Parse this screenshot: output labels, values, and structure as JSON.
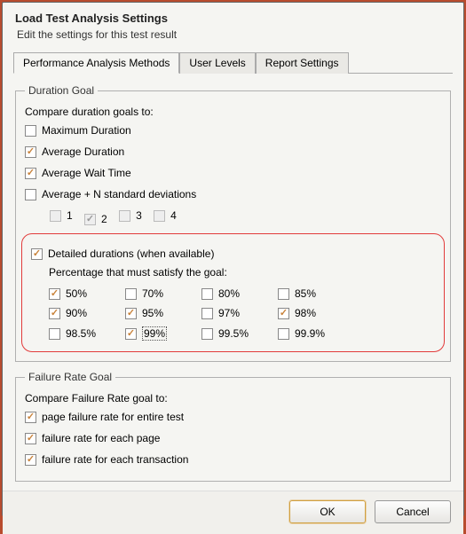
{
  "header": {
    "title": "Load Test Analysis Settings",
    "subtitle": "Edit the settings for this test result"
  },
  "tabs": [
    {
      "label": "Performance Analysis Methods",
      "active": true
    },
    {
      "label": "User Levels",
      "active": false
    },
    {
      "label": "Report Settings",
      "active": false
    }
  ],
  "durationGoal": {
    "legend": "Duration Goal",
    "compare": "Compare duration goals to:",
    "options": [
      {
        "label": "Maximum Duration",
        "checked": false
      },
      {
        "label": "Average Duration",
        "checked": true
      },
      {
        "label": "Average Wait Time",
        "checked": true
      },
      {
        "label": "Average + N standard deviations",
        "checked": false
      }
    ],
    "nDev": [
      {
        "label": "1",
        "checked": false
      },
      {
        "label": "2",
        "checked": true
      },
      {
        "label": "3",
        "checked": false
      },
      {
        "label": "4",
        "checked": false
      }
    ],
    "detailed": {
      "label": "Detailed durations (when available)",
      "checked": true
    },
    "pctLabel": "Percentage that must satisfy the goal:",
    "percents": [
      {
        "label": "50%",
        "checked": true
      },
      {
        "label": "70%",
        "checked": false
      },
      {
        "label": "80%",
        "checked": false
      },
      {
        "label": "85%",
        "checked": false
      },
      {
        "label": "90%",
        "checked": true
      },
      {
        "label": "95%",
        "checked": true
      },
      {
        "label": "97%",
        "checked": false
      },
      {
        "label": "98%",
        "checked": true
      },
      {
        "label": "98.5%",
        "checked": false
      },
      {
        "label": "99%",
        "checked": true,
        "focused": true
      },
      {
        "label": "99.5%",
        "checked": false
      },
      {
        "label": "99.9%",
        "checked": false
      }
    ]
  },
  "failureGoal": {
    "legend": "Failure Rate Goal",
    "compare": "Compare Failure Rate goal to:",
    "options": [
      {
        "label": "page failure rate for entire test",
        "checked": true
      },
      {
        "label": "failure rate for each page",
        "checked": true
      },
      {
        "label": "failure rate for each transaction",
        "checked": true
      }
    ]
  },
  "buttons": {
    "ok": "OK",
    "cancel": "Cancel"
  }
}
